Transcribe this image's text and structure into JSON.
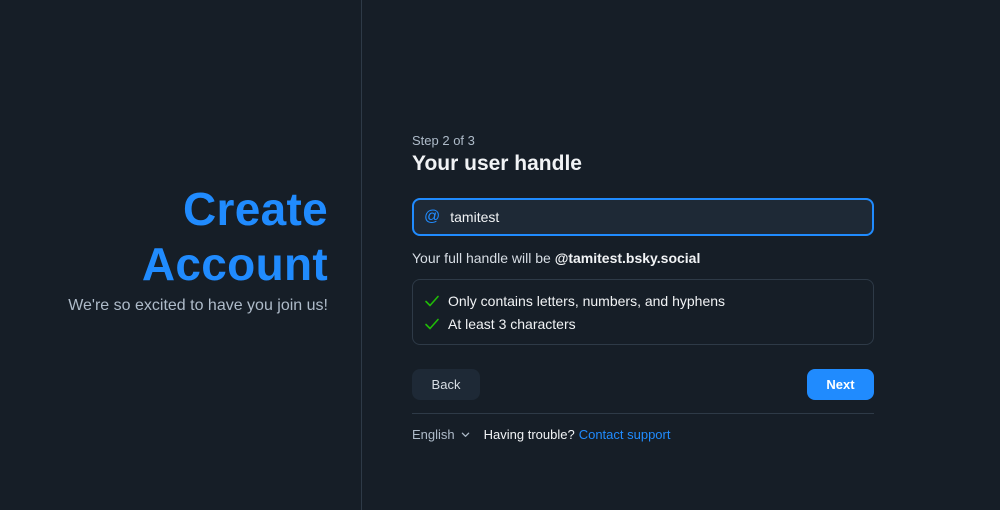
{
  "left": {
    "title_line1": "Create",
    "title_line2": "Account",
    "subtitle": "We're so excited to have you join us!"
  },
  "form": {
    "step": "Step 2 of 3",
    "heading": "Your user handle",
    "input_icon": "@",
    "input_value": "tamitest",
    "full_handle_prefix": "Your full handle will be ",
    "full_handle_value": "@tamitest.bsky.social",
    "checks": [
      {
        "label": "Only contains letters, numbers, and hyphens",
        "icon": "check-icon"
      },
      {
        "label": "At least 3 characters",
        "icon": "check-icon"
      }
    ],
    "back_label": "Back",
    "next_label": "Next"
  },
  "footer": {
    "language": "English",
    "trouble": "Having trouble?",
    "support": "Contact support"
  },
  "colors": {
    "accent": "#208bfe",
    "background": "#161e27",
    "check": "#20bc07"
  }
}
